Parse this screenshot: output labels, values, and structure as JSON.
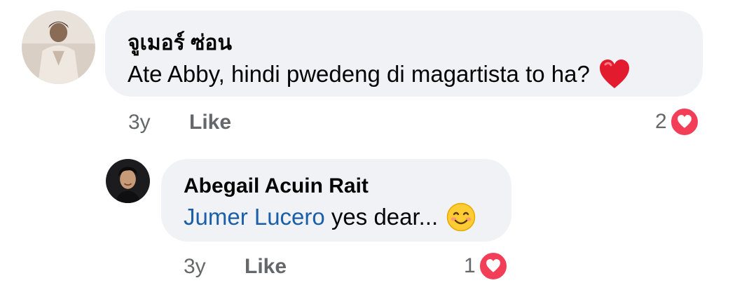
{
  "comments": [
    {
      "author": "จูเมอร์ ซ่อน",
      "text": "Ate Abby,  hindi pwedeng di magartista to ha?",
      "emoji": "red-heart",
      "time": "3y",
      "like_label": "Like",
      "reaction_count": "2",
      "reaction_icon": "love-reaction-icon"
    }
  ],
  "reply": {
    "author": "Abegail Acuin Rait",
    "mention": "Jumer Lucero",
    "text": " yes dear...",
    "emoji": "smiling-face",
    "time": "3y",
    "like_label": "Like",
    "reaction_count": "1",
    "reaction_icon": "love-reaction-icon"
  },
  "colors": {
    "bubble": "#f0f2f5",
    "mention": "#1b5fa8",
    "meta": "#65676b",
    "love": "#f33e58"
  }
}
